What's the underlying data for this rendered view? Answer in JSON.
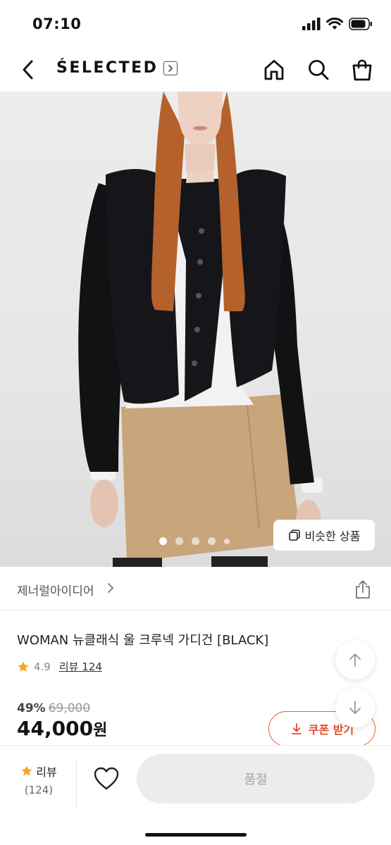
{
  "status_bar": {
    "time": "07:10"
  },
  "nav": {
    "brand": "ŚELECTED"
  },
  "hero": {
    "similar_button_label": "비슷한 상품",
    "slide_count": 5,
    "active_slide": 1
  },
  "seller": {
    "name": "제너럴아이디어"
  },
  "product": {
    "title": "WOMAN 뉴클래식 울 크루넥 가디건 [BLACK]",
    "rating": "4.9",
    "review_link": "리뷰 124",
    "discount": "49%",
    "original_price": "69,000",
    "price": "44,000",
    "price_unit": "원",
    "coupon_label": "쿠폰 받기"
  },
  "bottom_bar": {
    "review_label": "리뷰",
    "review_count": "(124)",
    "soldout_label": "품절"
  },
  "colors": {
    "accent": "#f15a3b",
    "star": "#f5a623",
    "soldout_bg": "#ececec"
  }
}
